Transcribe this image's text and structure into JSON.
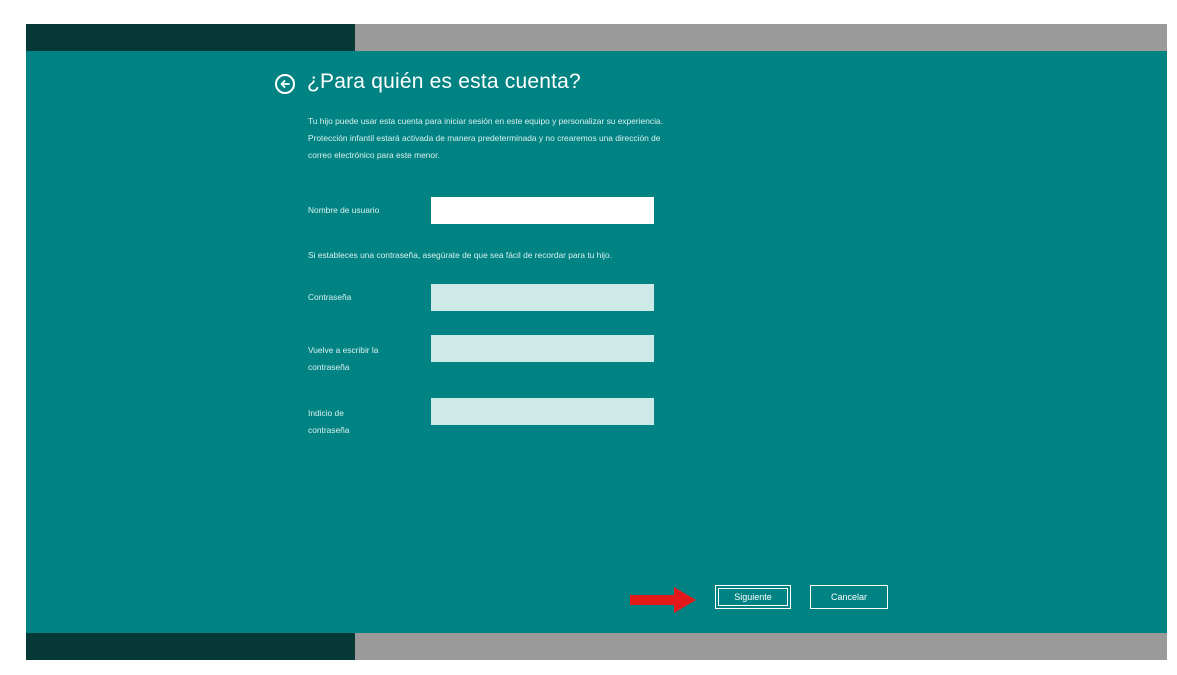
{
  "page": {
    "title": "¿Para quién es esta cuenta?",
    "description": [
      "Tu hijo puede usar esta cuenta para iniciar sesión en este equipo y personalizar su experiencia.",
      "Protección infantil estará activada de manera predeterminada y no crearemos una dirección de",
      "correo electrónico para este menor."
    ]
  },
  "form": {
    "username_label": "Nombre de usuario",
    "username_value": "",
    "password_note": "Si estableces una contraseña, asegúrate de que sea fácil de recordar para tu hijo.",
    "password_label": "Contraseña",
    "confirm_label_line1": "Vuelve a escribir la",
    "confirm_label_line2": "contraseña",
    "hint_label_line1": "Indicio de",
    "hint_label_line2": "contraseña"
  },
  "buttons": {
    "next_label": "Siguiente",
    "cancel_label": "Cancelar"
  },
  "colors": {
    "background": "#008382",
    "top_bar_dark": "#063836",
    "top_bar_light": "#9a9a9a",
    "annotation_arrow": "#e3191b"
  },
  "icons": {
    "back": "back-arrow-circle-icon",
    "annotation": "red-right-arrow-icon"
  }
}
